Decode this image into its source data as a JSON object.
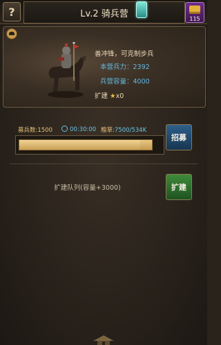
{
  "header": {
    "help_label": "?",
    "title": "Lv.2 骑兵营",
    "gem_count": "115"
  },
  "unit": {
    "description": "善冲锋，可克制步兵",
    "stats": [
      {
        "label": "本营兵力：",
        "value": "2392"
      },
      {
        "label": "兵营容量：",
        "value": "4000"
      }
    ],
    "expand_label": "扩建",
    "expand_value": "x0"
  },
  "recruit": {
    "count_label": "募兵数:",
    "count_value": "1500",
    "time_value": "00:30:00",
    "food_label": "粮草:",
    "food_value": "7500/534K",
    "slider_fraction": 0.91,
    "button_label": "招募"
  },
  "queue": {
    "label": "扩建队列(容量+3000)",
    "button_label": "扩建"
  },
  "colors": {
    "accent_blue": "#61b7e0",
    "gold": "#e6c27a"
  }
}
